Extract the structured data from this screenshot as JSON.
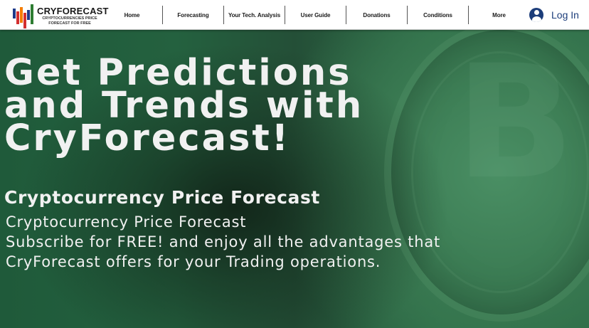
{
  "header": {
    "logo": {
      "title": "CRYFORECAST",
      "subtitle": "CRYPTOCURRENCIES PRICE FORECAST FOR FREE",
      "colors": [
        "#1e3a8a",
        "#d32f2f",
        "#2e7d32",
        "#f57c00"
      ]
    },
    "nav": [
      {
        "label": "Home"
      },
      {
        "label": "Forecasting"
      },
      {
        "label": "Your Tech. Analysis"
      },
      {
        "label": "User Guide"
      },
      {
        "label": "Donations"
      },
      {
        "label": "Conditions"
      },
      {
        "label": "More"
      }
    ],
    "login": {
      "label": "Log In",
      "icon": "user-avatar-icon",
      "color": "#1c3d7a"
    }
  },
  "hero": {
    "headline": "Get Predictions and Trends with CryForecast!",
    "subheading": "Cryptocurrency Price Forecast",
    "body_lines": [
      "Cryptocurrency Price Forecast",
      "Subscribe for FREE! and enjoy all the advantages that",
      "CryForecast offers for your Trading operations."
    ],
    "background_icon": "bitcoin-coin-icon",
    "background_color": "#2b6a45"
  }
}
